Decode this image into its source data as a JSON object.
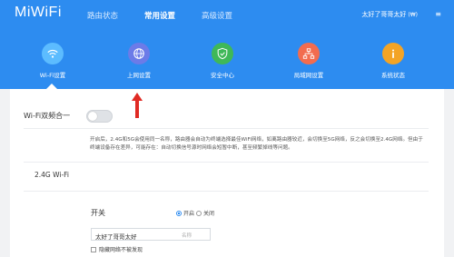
{
  "header": {
    "logo": "MiWiFi",
    "nav": [
      {
        "label": "路由状态"
      },
      {
        "label": "常用设置",
        "active": true
      },
      {
        "label": "高级设置"
      }
    ],
    "router_name": "太好了哥哥太好",
    "router_suffix": "(₩)",
    "menu_symbol": "≡",
    "accent_color": "#2d8cf0"
  },
  "tiles": [
    {
      "label": "Wi-Fi设置",
      "icon": "wifi-icon",
      "color": "#5cbcff"
    },
    {
      "label": "上网设置",
      "icon": "globe-icon",
      "color": "#6c7be8"
    },
    {
      "label": "安全中心",
      "icon": "shield-icon",
      "color": "#3fb858"
    },
    {
      "label": "局域网设置",
      "icon": "network-icon",
      "color": "#f26c4f"
    },
    {
      "label": "系统状态",
      "icon": "info-icon",
      "color": "#f3a426"
    }
  ],
  "content": {
    "dual_band_title": "Wi-Fi双频合一",
    "dual_band_desc": "开启后，2.4G和5G会使用同一名称，路由器会自动为终端选择最佳WiFi网络，如离路由器较近，会切换至5G网络，反之会切换至2.4G网络。但由于终端设备存在差异，可能存在：自动切换信号源时网络会短暂中断，甚至频繁掉线等问题。",
    "section_title": "2.4G Wi-Fi",
    "switch_label": "开关",
    "radio_on": "开启",
    "radio_off": "关闭",
    "ssid_value": "太好了哥哥太好",
    "ssid_placeholder": "名称",
    "hide_label": "隐藏网络不被发现"
  }
}
